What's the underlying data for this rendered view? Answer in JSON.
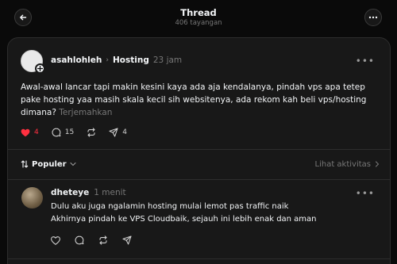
{
  "header": {
    "title": "Thread",
    "subtitle": "406 tayangan",
    "back_icon": "arrow-left-icon",
    "more_icon": "more-horizontal-icon"
  },
  "post": {
    "username": "asahlohleh",
    "community": "Hosting",
    "time": "23 jam",
    "text": "Awal-awal lancar tapi makin kesini kaya ada aja kendalanya, pindah vps apa tetep pake hosting yaa masih skala kecil sih websitenya, ada rekom kah beli vps/hosting dimana?",
    "translate_label": "Terjemahkan",
    "likes": "4",
    "liked": true,
    "comments": "15",
    "shares": "4",
    "like_color": "#ff3040"
  },
  "sort": {
    "label": "Populer",
    "activity_label": "Lihat aktivitas"
  },
  "reply": {
    "username": "dheteye",
    "time": "1 menit",
    "lines": [
      "Dulu aku juga ngalamin hosting mulai lemot pas traffic naik",
      "Akhirnya pindah ke VPS Cloudbaik, sejauh ini lebih enak dan aman"
    ]
  }
}
